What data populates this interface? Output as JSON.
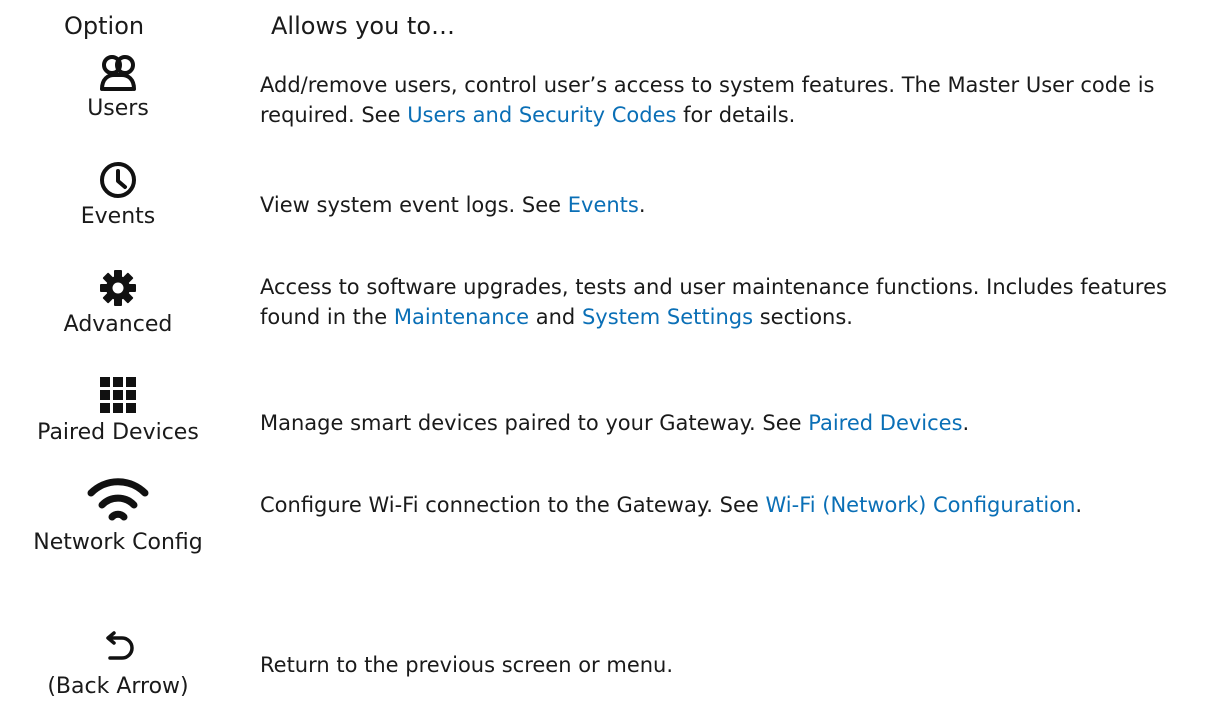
{
  "header": {
    "option": "Option",
    "allows": "Allows you to…"
  },
  "rows": [
    {
      "icon": "users-icon",
      "label": "Users",
      "text1": "Add/remove users, control user’s access to system features.  The Master User code is required.  See ",
      "link1": "Users and Security Codes",
      "text2": " for details."
    },
    {
      "icon": "clock-icon",
      "label": "Events",
      "text1": "View system event logs. See ",
      "link1": "Events",
      "text2": "."
    },
    {
      "icon": "gear-icon",
      "label": "Advanced",
      "text1": "Access to software upgrades, tests and user maintenance functions. Includes features found in the ",
      "link1": "Maintenance",
      "text2": " and ",
      "link2": "System Settings",
      "text3": " sections."
    },
    {
      "icon": "grid-icon",
      "label": "Paired Devices",
      "text1": "Manage smart devices paired to your Gateway. See ",
      "link1": "Paired Devices",
      "text2": "."
    },
    {
      "icon": "wifi-icon",
      "label": "Network Config",
      "text1": "Configure Wi-Fi connection to the Gateway. See ",
      "link1": "Wi-Fi (Network) Configuration",
      "text2": "."
    },
    {
      "icon": "back-arrow-icon",
      "label": "(Back Arrow)",
      "text1": "Return to the previous screen or menu."
    }
  ],
  "colors": {
    "link": "#0a6fb6",
    "text": "#1a1a1a"
  }
}
